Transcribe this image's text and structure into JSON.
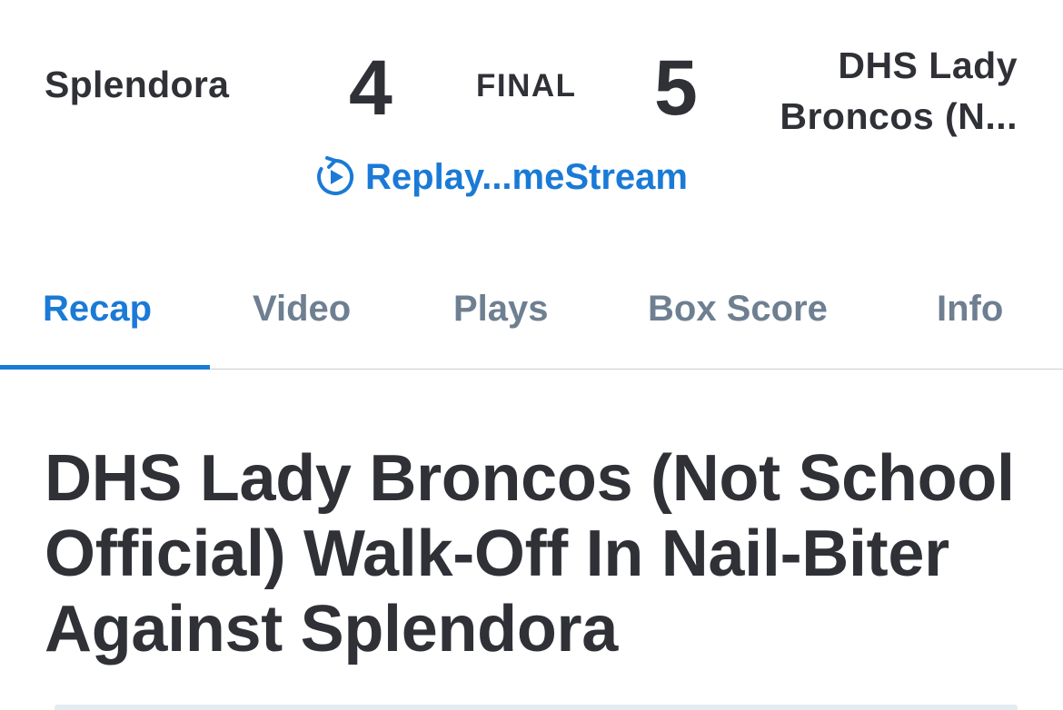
{
  "game": {
    "away_team": "Splendora",
    "away_score": "4",
    "status": "FINAL",
    "home_score": "5",
    "home_team_line1": "DHS Lady",
    "home_team_line2": "Broncos (N..."
  },
  "replay": {
    "label": "Replay...meStream",
    "icon": "replay-play-icon",
    "color": "#1a7ad6"
  },
  "tabs": [
    {
      "label": "Recap",
      "active": true
    },
    {
      "label": "Video",
      "active": false
    },
    {
      "label": "Plays",
      "active": false
    },
    {
      "label": "Box Score",
      "active": false
    },
    {
      "label": "Info",
      "active": false
    }
  ],
  "headline": "DHS Lady Broncos (Not School Official) Walk-Off In Nail-Biter Against Splendora",
  "colors": {
    "accent": "#1a7ad6",
    "text": "#2f3137",
    "tab_inactive": "#6e7f91"
  }
}
